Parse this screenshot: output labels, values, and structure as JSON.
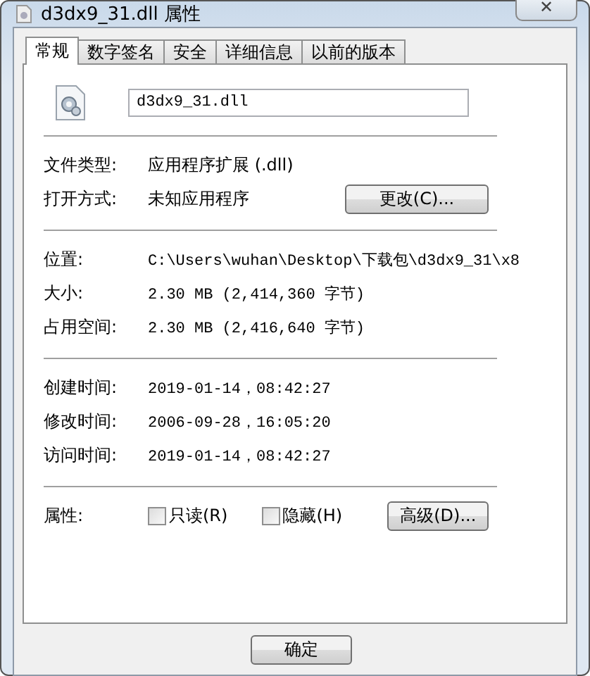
{
  "window": {
    "title": "d3dx9_31.dll 属性",
    "close": "✕"
  },
  "tabs": [
    {
      "label": "常规",
      "selected": true
    },
    {
      "label": "数字签名",
      "selected": false
    },
    {
      "label": "安全",
      "selected": false
    },
    {
      "label": "详细信息",
      "selected": false
    },
    {
      "label": "以前的版本",
      "selected": false
    }
  ],
  "file_name": "d3dx9_31.dll",
  "sections": [
    [
      {
        "label": "文件类型:",
        "value": "应用程序扩展 (.dll)"
      },
      {
        "label": "打开方式:",
        "value": "未知应用程序",
        "button": "更改(C)..."
      }
    ],
    [
      {
        "label": "位置:",
        "value": "C:\\Users\\wuhan\\Desktop\\下载包\\d3dx9_31\\x8"
      },
      {
        "label": "大小:",
        "value": "2.30 MB (2,414,360 字节)"
      },
      {
        "label": "占用空间:",
        "value": "2.30 MB (2,416,640 字节)"
      }
    ],
    [
      {
        "label": "创建时间:",
        "value": "2019-01-14，08:42:27"
      },
      {
        "label": "修改时间:",
        "value": "2006-09-28，16:05:20"
      },
      {
        "label": "访问时间:",
        "value": "2019-01-14，08:42:27"
      }
    ]
  ],
  "attributes": {
    "label": "属性:",
    "checkboxes": [
      {
        "label": "只读(R)",
        "checked": false
      },
      {
        "label": "隐藏(H)",
        "checked": false
      }
    ],
    "button": "高级(D)..."
  },
  "buttons": [
    "确定"
  ]
}
